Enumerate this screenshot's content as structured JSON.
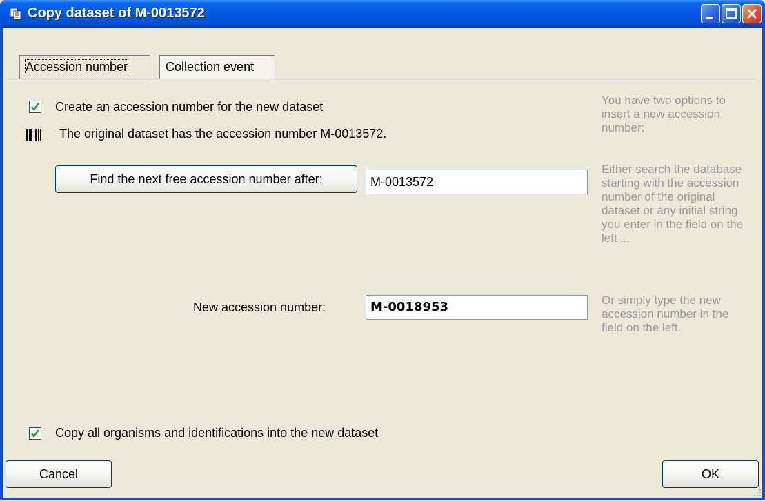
{
  "window": {
    "title": "Copy dataset of M-0013572",
    "controls": {
      "minimize": "minimize",
      "maximize": "maximize",
      "close": "close"
    }
  },
  "tabs": [
    {
      "label": "Accession number",
      "active": true
    },
    {
      "label": "Collection event",
      "active": false
    }
  ],
  "accession": {
    "create_checkbox_label": "Create an accession number for the new dataset",
    "create_checked": true,
    "original_info": "The original dataset has the accession number M-0013572.",
    "find_button_label": "Find the next free accession number after:",
    "find_input_value": "M-0013572",
    "new_label": "New accession number:",
    "new_input_value": "M-0018953"
  },
  "help": {
    "intro": "You have two options to insert a new accession number:",
    "option1": "Either search the database starting with the accession number of the original dataset or any initial string you enter in the field on the left ...",
    "option2": "Or simply type the new accession number in the field on the left."
  },
  "copy_all": {
    "label": "Copy all organisms and identifications into the new dataset",
    "checked": true
  },
  "footer": {
    "cancel_label": "Cancel",
    "ok_label": "OK"
  },
  "colors": {
    "titlebar": "#0a4fd6",
    "dialog_bg": "#ece9d8",
    "help_text": "#9a9a9a",
    "checkmark": "#21a121"
  },
  "icons": [
    "copy-icon",
    "barcode-icon",
    "checkmark-icon",
    "minimize-icon",
    "maximize-icon",
    "close-icon"
  ]
}
